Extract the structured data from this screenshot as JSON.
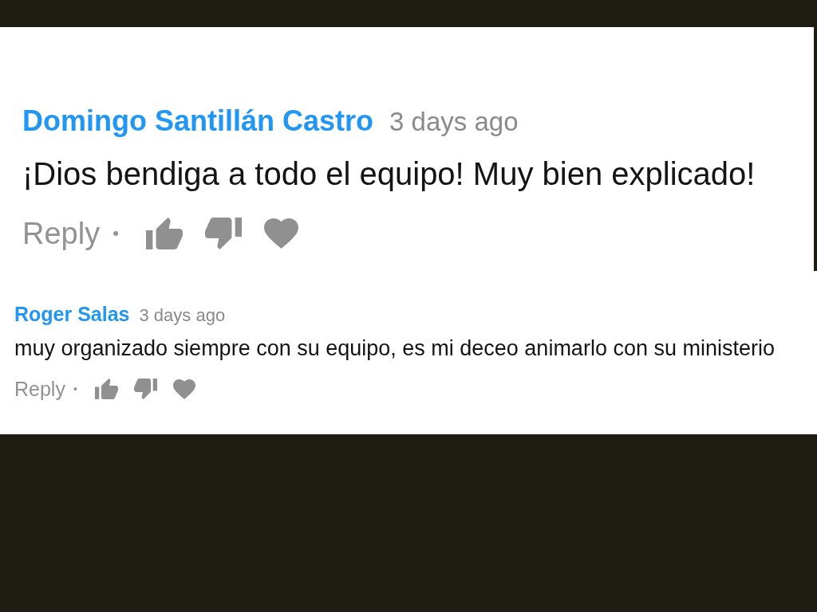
{
  "comments": [
    {
      "author": "Domingo Santillán Castro",
      "time": "3 days ago",
      "text": "¡Dios bendiga a todo el equipo! Muy bien explicado!",
      "reply": "Reply",
      "separator": "•"
    },
    {
      "author": "Roger Salas",
      "time": "3 days ago",
      "text": "muy organizado siempre con su equipo, es mi deceo animarlo con su ministerio",
      "reply": "Reply",
      "separator": "•"
    }
  ]
}
